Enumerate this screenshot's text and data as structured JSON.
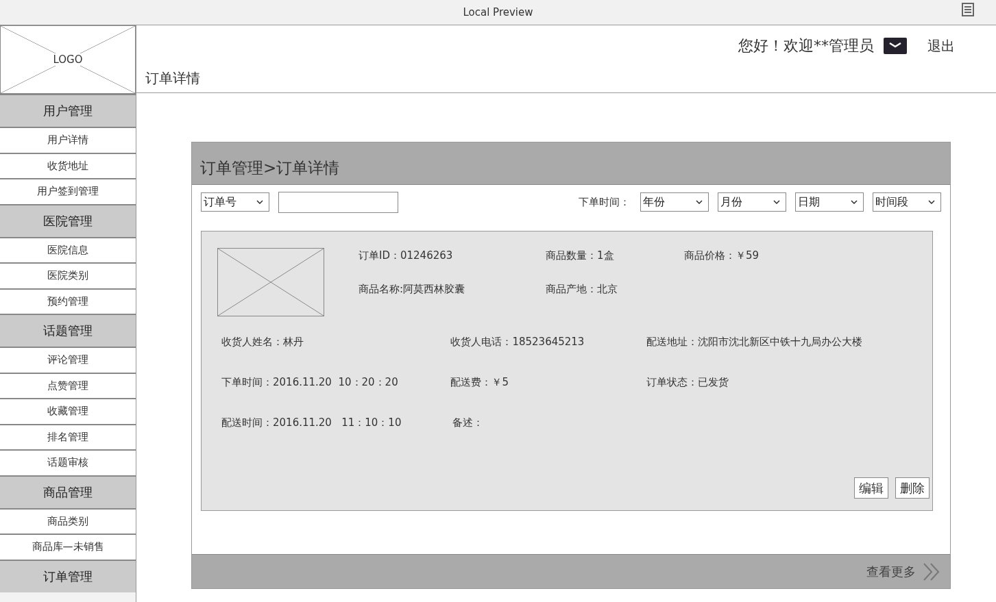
{
  "window": {
    "title": "Local Preview"
  },
  "logo": {
    "label": "LOGO"
  },
  "header": {
    "greeting": "您好！欢迎**管理员",
    "logout": "退出",
    "page_title": "订单详情"
  },
  "sidebar": {
    "groups": [
      {
        "title": "用户管理",
        "items": [
          "用户详情",
          "收货地址",
          "用户签到管理"
        ]
      },
      {
        "title": "医院管理",
        "items": [
          "医院信息",
          "医院类别",
          "预约管理"
        ]
      },
      {
        "title": "话题管理",
        "items": [
          "评论管理",
          "点赞管理",
          "收藏管理",
          "排名管理",
          "话题审核"
        ]
      },
      {
        "title": "商品管理",
        "items": [
          "商品类别",
          "商品库—未销售"
        ]
      },
      {
        "title": "订单管理"
      }
    ]
  },
  "panel": {
    "breadcrumb": "订单管理>订单详情",
    "filters": {
      "order_select": "订单号",
      "time_label": "下单时间：",
      "time_selects": [
        "年份",
        "月份",
        "日期",
        "时间段"
      ]
    },
    "order": {
      "product_fields": [
        [
          "订单ID：01246263",
          "商品数量：1盒",
          "商品价格：￥59"
        ],
        [
          "商品名称:阿莫西林胶囊",
          "商品产地：北京"
        ]
      ],
      "detail_fields": [
        [
          "收货人姓名：林丹",
          "收货人电话：18523645213",
          "配送地址：沈阳市沈北新区中铁十九局办公大楼"
        ],
        [
          "下单时间：2016.11.20  10：20：20",
          "配送费：￥5",
          "订单状态：已发货"
        ],
        [
          "配送时间：2016.11.20   11：10：10",
          "备述："
        ]
      ],
      "buttons": [
        "编辑",
        "删除"
      ]
    },
    "more": "查看更多"
  }
}
